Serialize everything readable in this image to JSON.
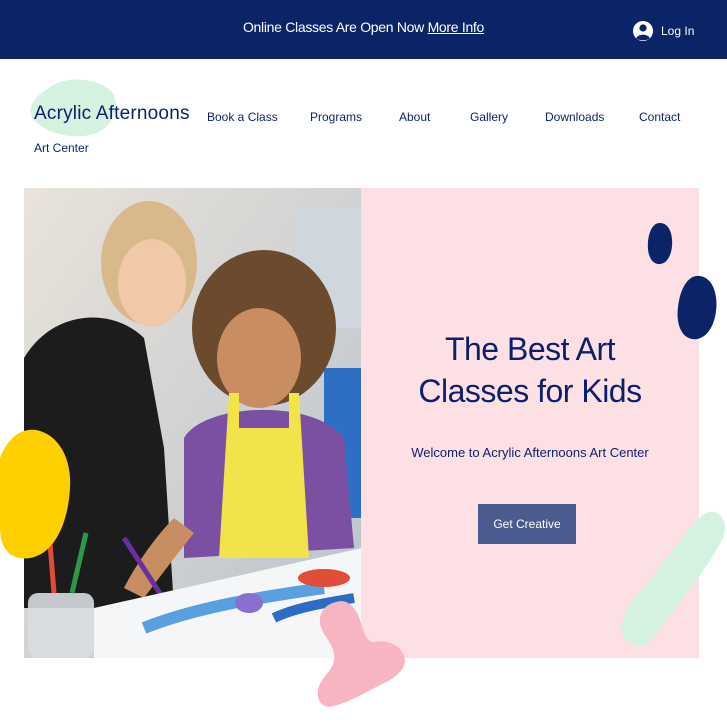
{
  "announcement": {
    "text": "Online Classes Are Open Now ",
    "link": "More Info"
  },
  "header": {
    "login": "Log In"
  },
  "logo": {
    "name": "Acrylic Afternoons",
    "subtitle": "Art Center"
  },
  "nav": [
    {
      "label": "Book a Class"
    },
    {
      "label": "Programs"
    },
    {
      "label": "About"
    },
    {
      "label": "Gallery"
    },
    {
      "label": "Downloads"
    },
    {
      "label": "Contact"
    }
  ],
  "hero": {
    "title_line1": "The Best Art",
    "title_line2": "Classes for Kids",
    "subtitle": "Welcome to Acrylic Afternoons Art Center",
    "cta": "Get Creative"
  },
  "colors": {
    "navy": "#0b2468",
    "pink_panel": "#fde0e4",
    "button": "#4c5b8f",
    "mint": "#d5f2e0",
    "yellow": "#ffd000",
    "pink_blob": "#f7b5c2"
  }
}
